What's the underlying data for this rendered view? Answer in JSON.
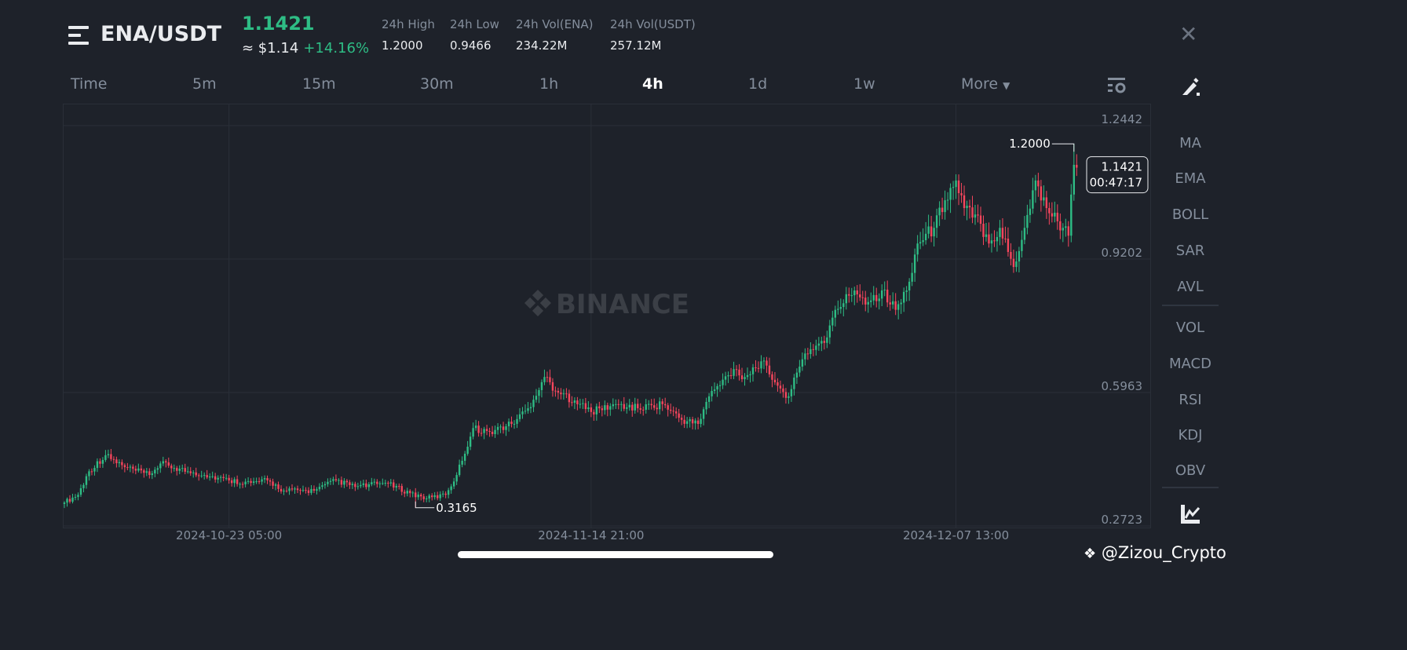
{
  "header": {
    "pair": "ENA/USDT",
    "last_price": "1.1421",
    "approx_usd": "≈ $1.14",
    "change_pct": "+14.16%",
    "stats": [
      {
        "label": "24h High",
        "value": "1.2000"
      },
      {
        "label": "24h Low",
        "value": "0.9466"
      },
      {
        "label": "24h Vol(ENA)",
        "value": "234.22M"
      },
      {
        "label": "24h Vol(USDT)",
        "value": "257.12M"
      }
    ]
  },
  "timeframes": {
    "time": "Time",
    "items": [
      "5m",
      "15m",
      "30m",
      "1h",
      "4h",
      "1d",
      "1w"
    ],
    "active": "4h",
    "more": "More"
  },
  "indicators": {
    "main": [
      "MA",
      "EMA",
      "BOLL",
      "SAR",
      "AVL"
    ],
    "sub": [
      "VOL",
      "MACD",
      "RSI",
      "KDJ",
      "OBV"
    ]
  },
  "watermark": "BINANCE",
  "credit": "@Zizou_Crypto",
  "colors": {
    "up": "#2ebd85",
    "down": "#f6465d",
    "bg": "#1e222a"
  },
  "chart_data": {
    "type": "candlestick",
    "interval": "4h",
    "candle_count": 370,
    "price_ticks": [
      "1.2442",
      "0.9202",
      "0.5963",
      "0.2723"
    ],
    "ylim": [
      0.2723,
      1.2442
    ],
    "date_labels": [
      {
        "label": "2024-10-23 05:00",
        "index": 60
      },
      {
        "label": "2024-11-14 21:00",
        "index": 192
      },
      {
        "label": "2024-12-07 13:00",
        "index": 325
      }
    ],
    "high_marker": {
      "label": "1.2000",
      "index": 368,
      "price": 1.2
    },
    "low_marker": {
      "label": "0.3165",
      "index": 128,
      "price": 0.3165
    },
    "last": {
      "price": "1.1421",
      "countdown": "00:47:17"
    },
    "close_anchors": [
      [
        0,
        0.329
      ],
      [
        5,
        0.348
      ],
      [
        9,
        0.405
      ],
      [
        15,
        0.444
      ],
      [
        22,
        0.415
      ],
      [
        31,
        0.396
      ],
      [
        35,
        0.424
      ],
      [
        45,
        0.405
      ],
      [
        51,
        0.396
      ],
      [
        60,
        0.383
      ],
      [
        68,
        0.377
      ],
      [
        74,
        0.383
      ],
      [
        80,
        0.358
      ],
      [
        91,
        0.358
      ],
      [
        99,
        0.383
      ],
      [
        106,
        0.367
      ],
      [
        117,
        0.377
      ],
      [
        126,
        0.352
      ],
      [
        132,
        0.339
      ],
      [
        139,
        0.348
      ],
      [
        143,
        0.396
      ],
      [
        149,
        0.51
      ],
      [
        155,
        0.501
      ],
      [
        163,
        0.52
      ],
      [
        169,
        0.558
      ],
      [
        175,
        0.634
      ],
      [
        180,
        0.596
      ],
      [
        186,
        0.577
      ],
      [
        192,
        0.549
      ],
      [
        201,
        0.568
      ],
      [
        209,
        0.558
      ],
      [
        218,
        0.568
      ],
      [
        225,
        0.53
      ],
      [
        231,
        0.52
      ],
      [
        235,
        0.587
      ],
      [
        244,
        0.653
      ],
      [
        248,
        0.634
      ],
      [
        254,
        0.672
      ],
      [
        261,
        0.606
      ],
      [
        264,
        0.587
      ],
      [
        270,
        0.691
      ],
      [
        274,
        0.71
      ],
      [
        278,
        0.73
      ],
      [
        281,
        0.797
      ],
      [
        288,
        0.844
      ],
      [
        293,
        0.816
      ],
      [
        298,
        0.844
      ],
      [
        303,
        0.797
      ],
      [
        307,
        0.844
      ],
      [
        311,
        0.958
      ],
      [
        317,
        0.996
      ],
      [
        321,
        1.063
      ],
      [
        325,
        1.111
      ],
      [
        328,
        1.044
      ],
      [
        334,
        1.006
      ],
      [
        337,
        0.958
      ],
      [
        341,
        0.996
      ],
      [
        346,
        0.901
      ],
      [
        350,
        0.996
      ],
      [
        354,
        1.111
      ],
      [
        358,
        1.044
      ],
      [
        364,
        0.996
      ],
      [
        366,
        0.977
      ],
      [
        368,
        1.149
      ],
      [
        369,
        1.1421
      ]
    ]
  }
}
